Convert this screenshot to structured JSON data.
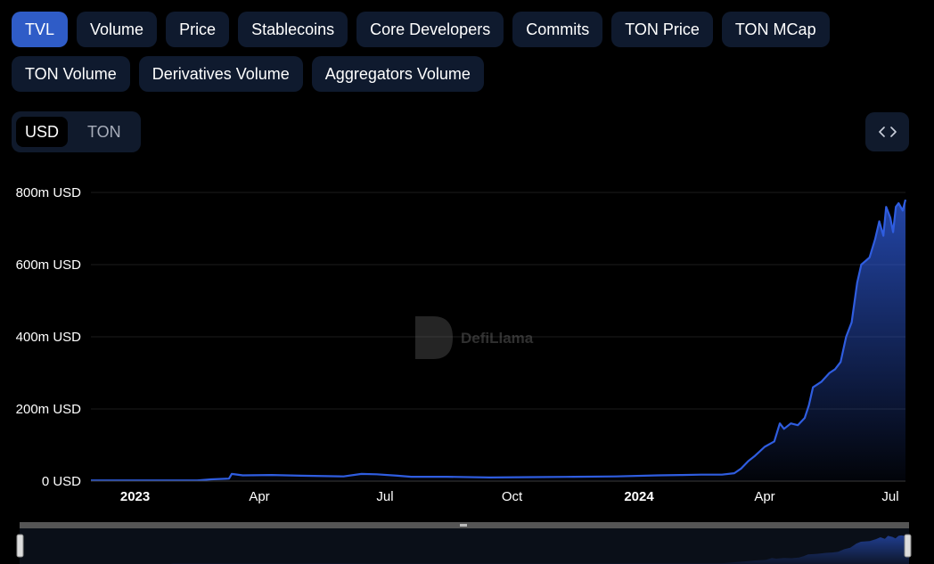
{
  "tabs": [
    [
      "TVL",
      "Volume",
      "Price",
      "Stablecoins",
      "Core Developers",
      "Commits",
      "TON Price",
      "TON MCap"
    ],
    [
      "TON Volume",
      "Derivatives Volume",
      "Aggregators Volume"
    ]
  ],
  "active_tab": "TVL",
  "denomination": {
    "options": [
      "USD",
      "TON"
    ],
    "selected": "USD"
  },
  "watermark": "DefiLlama",
  "colors": {
    "line": "#2f5de0",
    "active_tab": "#2f5cc7",
    "tab_bg": "#0f1a2e"
  },
  "chart_data": {
    "type": "area",
    "ylim": [
      0,
      800
    ],
    "y_ticks": [
      0,
      200,
      400,
      600,
      800
    ],
    "y_tick_labels": [
      "0 USD",
      "200m USD",
      "400m USD",
      "600m USD",
      "800m USD"
    ],
    "x_ticks": [
      {
        "date": "2023-01-01",
        "label": "2023",
        "bold": true
      },
      {
        "date": "2023-04-01",
        "label": "Apr",
        "bold": false
      },
      {
        "date": "2023-07-01",
        "label": "Jul",
        "bold": false
      },
      {
        "date": "2023-10-01",
        "label": "Oct",
        "bold": false
      },
      {
        "date": "2024-01-01",
        "label": "2024",
        "bold": true
      },
      {
        "date": "2024-04-01",
        "label": "Apr",
        "bold": false
      },
      {
        "date": "2024-07-01",
        "label": "Jul",
        "bold": false
      }
    ],
    "xlim": [
      "2022-11-30",
      "2024-07-12"
    ],
    "grid": true,
    "series": [
      {
        "x": [
          "2022-11-30",
          "2023-02-15",
          "2023-02-25",
          "2023-03-10",
          "2023-03-12",
          "2023-03-20",
          "2023-04-10",
          "2023-05-01",
          "2023-06-01",
          "2023-06-14",
          "2023-06-25",
          "2023-07-10",
          "2023-07-20",
          "2023-08-15",
          "2023-09-15",
          "2023-10-15",
          "2023-11-15",
          "2023-12-15",
          "2024-01-15",
          "2024-02-01",
          "2024-02-15",
          "2024-03-01",
          "2024-03-10",
          "2024-03-15",
          "2024-03-20",
          "2024-03-25",
          "2024-04-01",
          "2024-04-08",
          "2024-04-12",
          "2024-04-15",
          "2024-04-20",
          "2024-04-25",
          "2024-04-30",
          "2024-05-03",
          "2024-05-06",
          "2024-05-12",
          "2024-05-18",
          "2024-05-22",
          "2024-05-26",
          "2024-05-30",
          "2024-06-03",
          "2024-06-07",
          "2024-06-10",
          "2024-06-13",
          "2024-06-16",
          "2024-06-20",
          "2024-06-23",
          "2024-06-26",
          "2024-06-28",
          "2024-07-01",
          "2024-07-03",
          "2024-07-05",
          "2024-07-07",
          "2024-07-10",
          "2024-07-12"
        ],
        "y": [
          2,
          2,
          5,
          7,
          20,
          16,
          17,
          15,
          13,
          20,
          19,
          15,
          12,
          12,
          10,
          11,
          12,
          13,
          16,
          17,
          18,
          18,
          22,
          35,
          55,
          70,
          95,
          110,
          160,
          145,
          160,
          155,
          175,
          210,
          260,
          275,
          300,
          310,
          330,
          400,
          440,
          550,
          600,
          610,
          620,
          670,
          720,
          680,
          760,
          730,
          690,
          760,
          770,
          750,
          780
        ]
      }
    ]
  }
}
